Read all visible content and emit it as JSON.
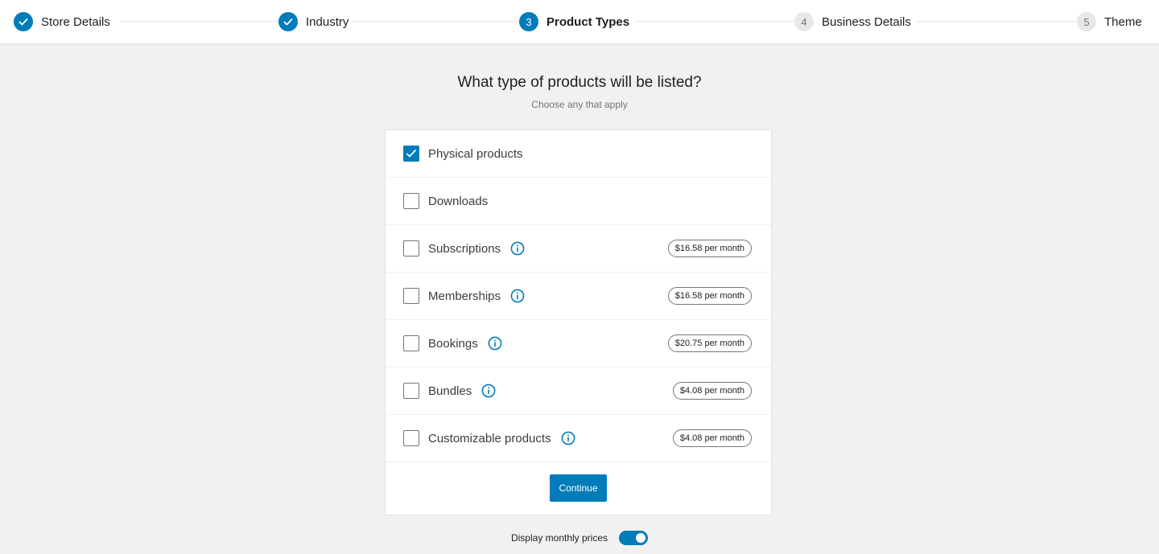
{
  "stepper": {
    "steps": [
      {
        "number": "1",
        "label": "Store Details",
        "state": "complete"
      },
      {
        "number": "2",
        "label": "Industry",
        "state": "complete"
      },
      {
        "number": "3",
        "label": "Product Types",
        "state": "current"
      },
      {
        "number": "4",
        "label": "Business Details",
        "state": "upcoming"
      },
      {
        "number": "5",
        "label": "Theme",
        "state": "upcoming"
      }
    ]
  },
  "heading": {
    "title": "What type of products will be listed?",
    "subtitle": "Choose any that apply"
  },
  "product_types": [
    {
      "label": "Physical products",
      "checked": true,
      "info": false,
      "price": ""
    },
    {
      "label": "Downloads",
      "checked": false,
      "info": false,
      "price": ""
    },
    {
      "label": "Subscriptions",
      "checked": false,
      "info": true,
      "price": "$16.58 per month"
    },
    {
      "label": "Memberships",
      "checked": false,
      "info": true,
      "price": "$16.58 per month"
    },
    {
      "label": "Bookings",
      "checked": false,
      "info": true,
      "price": "$20.75 per month"
    },
    {
      "label": "Bundles",
      "checked": false,
      "info": true,
      "price": "$4.08 per month"
    },
    {
      "label": "Customizable products",
      "checked": false,
      "info": true,
      "price": "$4.08 per month"
    }
  ],
  "actions": {
    "continue_label": "Continue"
  },
  "toggle": {
    "label": "Display monthly prices",
    "on": true
  },
  "colors": {
    "accent": "#007cba",
    "background": "#f1f1f1",
    "card": "#ffffff"
  },
  "icons": {
    "complete_step": "check-icon",
    "checkbox_checked": "check-icon",
    "info": "info-icon"
  }
}
